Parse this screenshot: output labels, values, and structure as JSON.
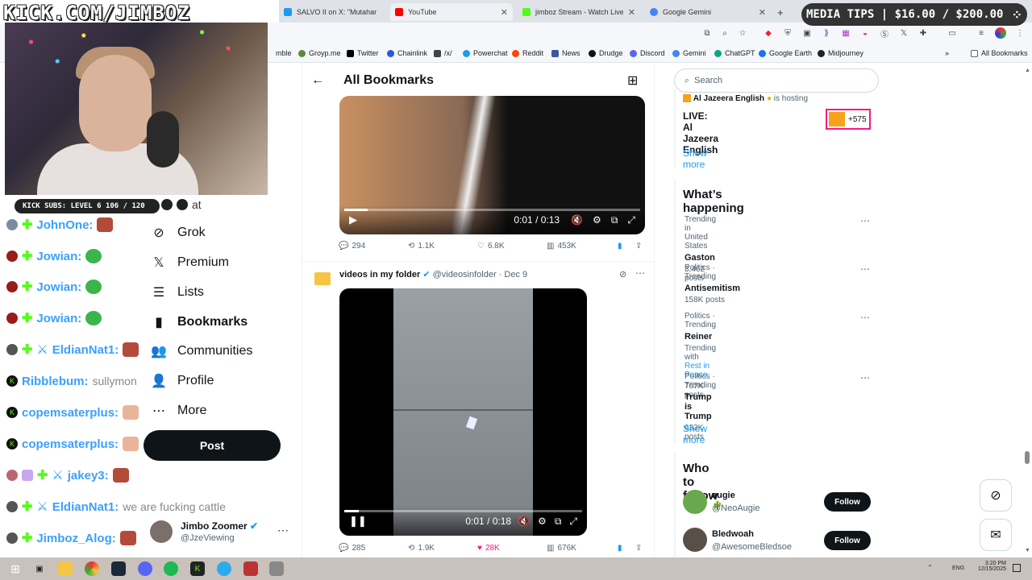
{
  "overlay": {
    "title": "KICK.COM/JIMBOZ",
    "subs": "KICK SUBS: LEVEL 6 106 / 120",
    "media_tips": "MEDIA TIPS | $16.00 / $200.00"
  },
  "browser": {
    "tabs": [
      {
        "label": "SALVO II on X: \"Mutahar G",
        "color": "#1d9bf0"
      },
      {
        "label": "YouTube",
        "color": "#ff0000"
      },
      {
        "label": "jimboz Stream - Watch Live on",
        "color": "#53fc18"
      },
      {
        "label": "Google Gemini",
        "color": "#4285f4"
      }
    ],
    "bookmarks": [
      {
        "label": "mble",
        "color": "#888"
      },
      {
        "label": "Groyp.me",
        "color": "#5c8a3a"
      },
      {
        "label": "Twitter",
        "color": "#000"
      },
      {
        "label": "Chainlink",
        "color": "#2a5ada"
      },
      {
        "label": "/x/",
        "color": "#444"
      },
      {
        "label": "Powerchat",
        "color": "#1d9bf0"
      },
      {
        "label": "Reddit",
        "color": "#ff4500"
      },
      {
        "label": "News",
        "color": "#3b5998"
      },
      {
        "label": "Drudge",
        "color": "#111"
      },
      {
        "label": "Discord",
        "color": "#5865f2"
      },
      {
        "label": "Gemini",
        "color": "#4285f4"
      },
      {
        "label": "ChatGPT",
        "color": "#10a37f"
      },
      {
        "label": "Google Earth",
        "color": "#1a73e8"
      },
      {
        "label": "Midjourney",
        "color": "#222"
      },
      {
        "label": "All Bookmarks",
        "color": "#666"
      }
    ]
  },
  "chat": [
    {
      "name": "at",
      "msg": ""
    },
    {
      "name": "JohnOne:",
      "msg": ""
    },
    {
      "name": "Jowian:",
      "msg": ""
    },
    {
      "name": "Jowian:",
      "msg": ""
    },
    {
      "name": "Jowian:",
      "msg": ""
    },
    {
      "name": "EldianNat1:",
      "msg": ""
    },
    {
      "name": "Ribblebum:",
      "msg": "sullymon"
    },
    {
      "name": "copemsaterplus:",
      "msg": ""
    },
    {
      "name": "copemsaterplus:",
      "msg": ""
    },
    {
      "name": "jakey3:",
      "msg": ""
    },
    {
      "name": "EldianNat1:",
      "msg": "we are fucking cattle"
    },
    {
      "name": "Jimboz_Alog:",
      "msg": ""
    }
  ],
  "nav": {
    "items": [
      {
        "label": "Grok",
        "icon": "grok-icon",
        "glyph": "⊘"
      },
      {
        "label": "Premium",
        "icon": "x-logo-icon",
        "glyph": "𝕏"
      },
      {
        "label": "Lists",
        "icon": "list-icon",
        "glyph": "☰"
      },
      {
        "label": "Bookmarks",
        "icon": "bookmark-icon",
        "glyph": "▮"
      },
      {
        "label": "Communities",
        "icon": "communities-icon",
        "glyph": "👥"
      },
      {
        "label": "Profile",
        "icon": "profile-icon",
        "glyph": "👤"
      },
      {
        "label": "More",
        "icon": "more-icon",
        "glyph": "⋯"
      }
    ],
    "post": "Post",
    "account": {
      "name": "Jimbo Zoomer",
      "handle": "@JzeViewing"
    }
  },
  "main": {
    "title": "All Bookmarks",
    "post1": {
      "time": "0:01 / 0:13",
      "replies": "294",
      "reposts": "1.1K",
      "likes": "6.8K",
      "views": "453K",
      "progress": 0.08
    },
    "post2": {
      "author": "videos in my folder",
      "handle": "@videosinfolder",
      "date": "· Dec 9",
      "time": "0:01 / 0:18",
      "replies": "285",
      "reposts": "1.9K",
      "likes": "28K",
      "views": "676K",
      "progress": 0.06
    }
  },
  "right": {
    "search_placeholder": "Search",
    "live": {
      "host": "Al Jazeera English",
      "hosting": "is hosting",
      "title": "LIVE: Al Jazeera English",
      "count": "+575"
    },
    "show_more": "Show more",
    "happening_title": "What’s happening",
    "trends": [
      {
        "meta": "Trending in United States",
        "title": "Gaston",
        "posts": "3,462 posts"
      },
      {
        "meta": "Politics · Trending",
        "title": "Antisemitism",
        "posts": "158K posts"
      },
      {
        "meta": "Politics · Trending",
        "title": "Reiner",
        "with": "Trending with",
        "with_link": "Rest in Peace",
        "posts": "767K posts"
      },
      {
        "meta": "Politics · Trending",
        "title": "Trump is Trump",
        "posts": "633K posts"
      }
    ],
    "who_title": "Who to follow",
    "follows": [
      {
        "name": "augie🌵",
        "handle": "@NeoAugie",
        "button": "Follow"
      },
      {
        "name": "Bledwoah",
        "handle": "@AwesomeBledsoe",
        "button": "Follow"
      }
    ]
  },
  "taskbar": {
    "lang": "ENG",
    "time": "3:20 PM",
    "date": "12/15/2025"
  }
}
